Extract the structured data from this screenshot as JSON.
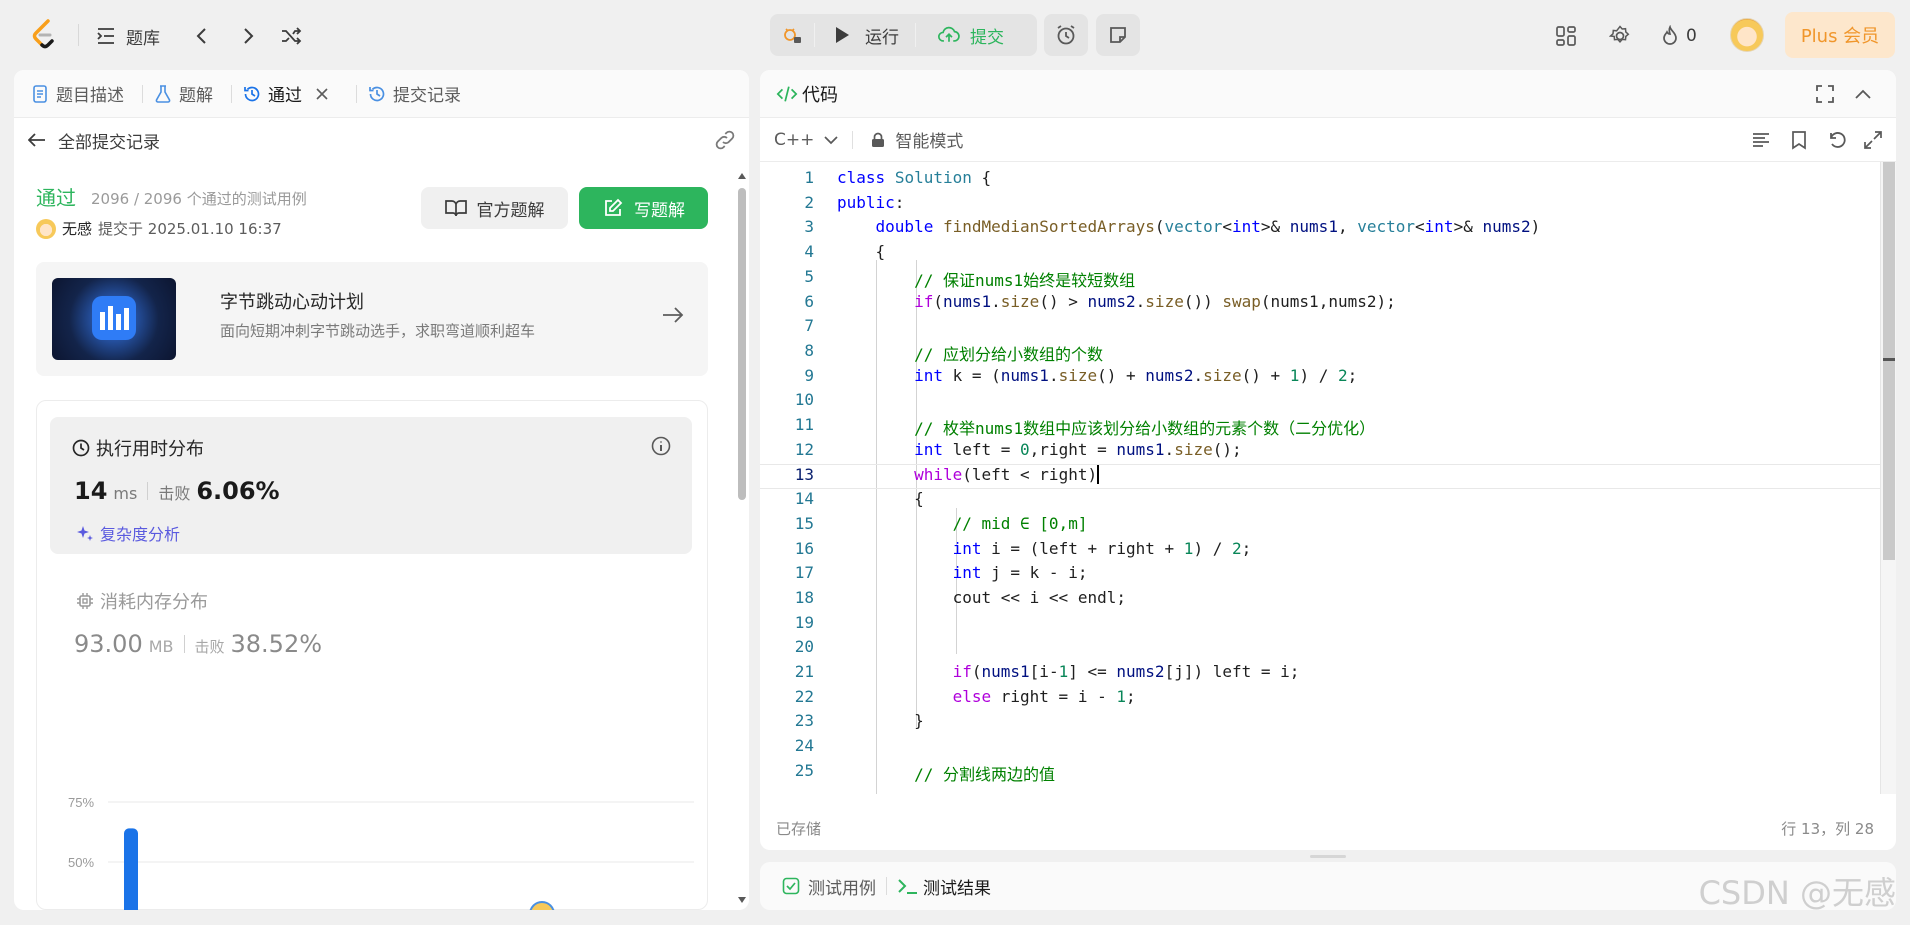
{
  "topbar": {
    "problems_label": "题库",
    "run_label": "运行",
    "submit_label": "提交",
    "streak_count": "0",
    "plus_label": "Plus 会员"
  },
  "left_tabs": {
    "description": "题目描述",
    "solutions": "题解",
    "accepted": "通过",
    "submissions": "提交记录"
  },
  "back_label": "全部提交记录",
  "result": {
    "status": "通过",
    "testcases": "2096 / 2096 个通过的测试用例",
    "user": "无感",
    "submitted_at": "提交于 2025.01.10 16:37",
    "official_btn": "官方题解",
    "write_btn": "写题解"
  },
  "promo": {
    "title": "字节跳动心动计划",
    "subtitle": "面向短期冲刺字节跳动选手，求职弯道顺利超车"
  },
  "runtime": {
    "title": "执行用时分布",
    "value": "14",
    "unit": "ms",
    "beat_label": "击败",
    "beat_pct": "6.06%",
    "complexity": "复杂度分析"
  },
  "memory": {
    "title": "消耗内存分布",
    "value": "93.00",
    "unit": "MB",
    "beat_label": "击败",
    "beat_pct": "38.52%"
  },
  "chart_data": {
    "type": "bar",
    "yticks": [
      "75%",
      "50%",
      "25%"
    ],
    "ylim": [
      0,
      100
    ],
    "bars": [
      {
        "value": 64,
        "color": "#1a73e8"
      }
    ]
  },
  "code": {
    "title": "代码",
    "language": "C++",
    "mode": "智能模式",
    "saved": "已存储",
    "position": "行 13，列 28",
    "lines": [
      "1",
      "2",
      "3",
      "4",
      "5",
      "6",
      "7",
      "8",
      "9",
      "10",
      "11",
      "12",
      "13",
      "14",
      "15",
      "16",
      "17",
      "18",
      "19",
      "20",
      "21",
      "22",
      "23",
      "24",
      "25"
    ]
  },
  "bottom": {
    "testcase": "测试用例",
    "testresult": "测试结果"
  },
  "watermark": "CSDN @无感"
}
